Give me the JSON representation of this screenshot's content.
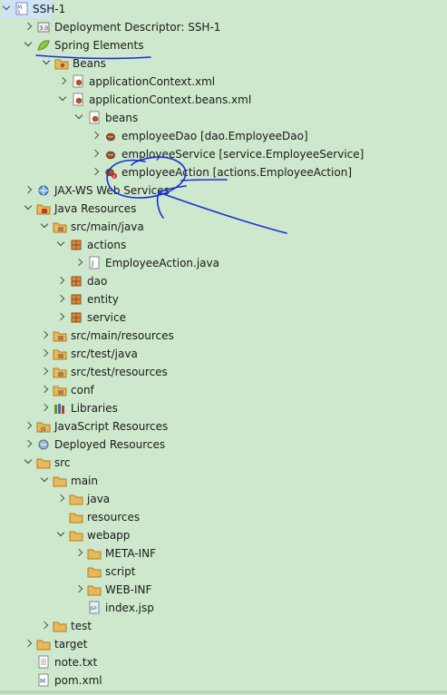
{
  "tree": [
    {
      "label": "SSH-1",
      "icon": "maven-project-icon",
      "twisty": "open"
    },
    {
      "label": "Deployment Descriptor: SSH-1",
      "icon": "deployment-descriptor-icon",
      "twisty": "closed"
    },
    {
      "label": "Spring Elements",
      "icon": "spring-leaf-icon",
      "twisty": "open"
    },
    {
      "label": "Beans",
      "icon": "beans-folder-icon",
      "twisty": "open"
    },
    {
      "label": "applicationContext.xml",
      "icon": "spring-xml-icon",
      "twisty": "closed"
    },
    {
      "label": "applicationContext.beans.xml",
      "icon": "spring-xml-icon",
      "twisty": "open"
    },
    {
      "label": "beans",
      "icon": "beans-config-icon",
      "twisty": "open"
    },
    {
      "label": "employeeDao [dao.EmployeeDao]",
      "icon": "bean-icon",
      "twisty": "closed"
    },
    {
      "label": "employeeService [service.EmployeeService]",
      "icon": "bean-icon",
      "twisty": "closed"
    },
    {
      "label": "employeeAction [actions.EmployeeAction]",
      "icon": "bean-error-icon",
      "twisty": "closed"
    },
    {
      "label": "JAX-WS Web Services",
      "icon": "web-services-icon",
      "twisty": "closed"
    },
    {
      "label": "Java Resources",
      "icon": "java-resources-icon",
      "twisty": "open"
    },
    {
      "label": "src/main/java",
      "icon": "source-folder-icon",
      "twisty": "open"
    },
    {
      "label": "actions",
      "icon": "package-icon",
      "twisty": "open"
    },
    {
      "label": "EmployeeAction.java",
      "icon": "java-file-icon",
      "twisty": "closed"
    },
    {
      "label": "dao",
      "icon": "package-icon",
      "twisty": "closed"
    },
    {
      "label": "entity",
      "icon": "package-icon",
      "twisty": "closed"
    },
    {
      "label": "service",
      "icon": "package-icon",
      "twisty": "closed"
    },
    {
      "label": "src/main/resources",
      "icon": "source-folder-icon",
      "twisty": "closed"
    },
    {
      "label": "src/test/java",
      "icon": "source-folder-icon",
      "twisty": "closed"
    },
    {
      "label": "src/test/resources",
      "icon": "source-folder-icon",
      "twisty": "closed"
    },
    {
      "label": "conf",
      "icon": "source-folder-icon",
      "twisty": "closed"
    },
    {
      "label": "Libraries",
      "icon": "libraries-icon",
      "twisty": "closed"
    },
    {
      "label": "JavaScript Resources",
      "icon": "javascript-resources-icon",
      "twisty": "closed"
    },
    {
      "label": "Deployed Resources",
      "icon": "deployed-resources-icon",
      "twisty": "closed"
    },
    {
      "label": "src",
      "icon": "folder-icon",
      "twisty": "open"
    },
    {
      "label": "main",
      "icon": "folder-icon",
      "twisty": "open"
    },
    {
      "label": "java",
      "icon": "folder-icon",
      "twisty": "closed"
    },
    {
      "label": "resources",
      "icon": "folder-icon",
      "twisty": "none"
    },
    {
      "label": "webapp",
      "icon": "folder-icon",
      "twisty": "open"
    },
    {
      "label": "META-INF",
      "icon": "folder-icon",
      "twisty": "closed"
    },
    {
      "label": "script",
      "icon": "folder-icon",
      "twisty": "none"
    },
    {
      "label": "WEB-INF",
      "icon": "folder-icon",
      "twisty": "closed"
    },
    {
      "label": "index.jsp",
      "icon": "jsp-file-icon",
      "twisty": "none"
    },
    {
      "label": "test",
      "icon": "folder-icon",
      "twisty": "closed"
    },
    {
      "label": "target",
      "icon": "folder-icon",
      "twisty": "closed"
    },
    {
      "label": "note.txt",
      "icon": "text-file-icon",
      "twisty": "none"
    },
    {
      "label": "pom.xml",
      "icon": "maven-pom-icon",
      "twisty": "none"
    }
  ],
  "colors": {
    "background": "#cde8cd",
    "annotation_ink": "#1a2fd6",
    "folder": "#e8b85a",
    "error": "#d8231b"
  }
}
